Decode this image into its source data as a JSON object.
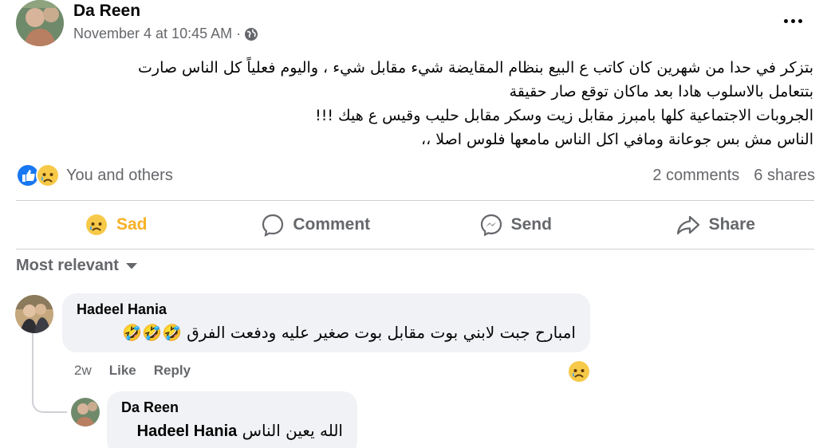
{
  "post": {
    "author": "Da Reen",
    "date": "November 4 at 10:45 AM ·",
    "text_lines": [
      "بتزكر في حدا من شهرين كان كاتب ع البيع بنظام المقايضة شيء مقابل شيء ، واليوم فعلياً كل الناس صارت",
      "بتتعامل بالاسلوب هادا بعد ماكان توقع صار حقيقة",
      "الجروبات الاجتماعية كلها بامبرز مقابل زيت وسكر مقابل حليب وقيس ع هيك !!!",
      "الناس مش بس جوعانة ومافي اكل الناس مامعها فلوس اصلا ،،"
    ],
    "reactors": "You and others",
    "comments_count": "2 comments",
    "shares_count": "6 shares"
  },
  "actions": {
    "sad": "Sad",
    "comment": "Comment",
    "send": "Send",
    "share": "Share"
  },
  "sort_label": "Most relevant",
  "comments": [
    {
      "author": "Hadeel Hania",
      "text": "امبارح جبت لابني بوت مقابل بوت صغير عليه ودفعت الفرق 🤣🤣🤣",
      "time": "2w",
      "like": "Like",
      "reply": "Reply"
    },
    {
      "author": "Da Reen",
      "mention": "Hadeel Hania",
      "text": "الله يعين الناس"
    }
  ],
  "icons": {
    "globe": "globe-icon",
    "more": "more-options-icon",
    "like": "like-reaction-icon",
    "sad": "sad-reaction-icon",
    "comment": "comment-bubble-icon",
    "send": "messenger-icon",
    "share": "share-arrow-icon",
    "caret": "caret-down-icon"
  },
  "colors": {
    "text": "#050505",
    "secondary": "#65676b",
    "sad": "#f7b125",
    "like": "#1877f2",
    "bubble": "#f0f2f5"
  }
}
